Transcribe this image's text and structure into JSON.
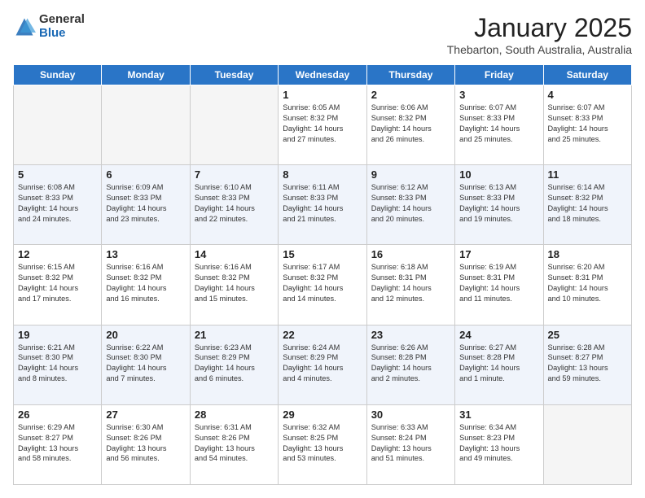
{
  "header": {
    "logo_general": "General",
    "logo_blue": "Blue",
    "month_title": "January 2025",
    "location": "Thebarton, South Australia, Australia"
  },
  "weekdays": [
    "Sunday",
    "Monday",
    "Tuesday",
    "Wednesday",
    "Thursday",
    "Friday",
    "Saturday"
  ],
  "weeks": [
    [
      {
        "day": "",
        "info": ""
      },
      {
        "day": "",
        "info": ""
      },
      {
        "day": "",
        "info": ""
      },
      {
        "day": "1",
        "info": "Sunrise: 6:05 AM\nSunset: 8:32 PM\nDaylight: 14 hours\nand 27 minutes."
      },
      {
        "day": "2",
        "info": "Sunrise: 6:06 AM\nSunset: 8:32 PM\nDaylight: 14 hours\nand 26 minutes."
      },
      {
        "day": "3",
        "info": "Sunrise: 6:07 AM\nSunset: 8:33 PM\nDaylight: 14 hours\nand 25 minutes."
      },
      {
        "day": "4",
        "info": "Sunrise: 6:07 AM\nSunset: 8:33 PM\nDaylight: 14 hours\nand 25 minutes."
      }
    ],
    [
      {
        "day": "5",
        "info": "Sunrise: 6:08 AM\nSunset: 8:33 PM\nDaylight: 14 hours\nand 24 minutes."
      },
      {
        "day": "6",
        "info": "Sunrise: 6:09 AM\nSunset: 8:33 PM\nDaylight: 14 hours\nand 23 minutes."
      },
      {
        "day": "7",
        "info": "Sunrise: 6:10 AM\nSunset: 8:33 PM\nDaylight: 14 hours\nand 22 minutes."
      },
      {
        "day": "8",
        "info": "Sunrise: 6:11 AM\nSunset: 8:33 PM\nDaylight: 14 hours\nand 21 minutes."
      },
      {
        "day": "9",
        "info": "Sunrise: 6:12 AM\nSunset: 8:33 PM\nDaylight: 14 hours\nand 20 minutes."
      },
      {
        "day": "10",
        "info": "Sunrise: 6:13 AM\nSunset: 8:33 PM\nDaylight: 14 hours\nand 19 minutes."
      },
      {
        "day": "11",
        "info": "Sunrise: 6:14 AM\nSunset: 8:32 PM\nDaylight: 14 hours\nand 18 minutes."
      }
    ],
    [
      {
        "day": "12",
        "info": "Sunrise: 6:15 AM\nSunset: 8:32 PM\nDaylight: 14 hours\nand 17 minutes."
      },
      {
        "day": "13",
        "info": "Sunrise: 6:16 AM\nSunset: 8:32 PM\nDaylight: 14 hours\nand 16 minutes."
      },
      {
        "day": "14",
        "info": "Sunrise: 6:16 AM\nSunset: 8:32 PM\nDaylight: 14 hours\nand 15 minutes."
      },
      {
        "day": "15",
        "info": "Sunrise: 6:17 AM\nSunset: 8:32 PM\nDaylight: 14 hours\nand 14 minutes."
      },
      {
        "day": "16",
        "info": "Sunrise: 6:18 AM\nSunset: 8:31 PM\nDaylight: 14 hours\nand 12 minutes."
      },
      {
        "day": "17",
        "info": "Sunrise: 6:19 AM\nSunset: 8:31 PM\nDaylight: 14 hours\nand 11 minutes."
      },
      {
        "day": "18",
        "info": "Sunrise: 6:20 AM\nSunset: 8:31 PM\nDaylight: 14 hours\nand 10 minutes."
      }
    ],
    [
      {
        "day": "19",
        "info": "Sunrise: 6:21 AM\nSunset: 8:30 PM\nDaylight: 14 hours\nand 8 minutes."
      },
      {
        "day": "20",
        "info": "Sunrise: 6:22 AM\nSunset: 8:30 PM\nDaylight: 14 hours\nand 7 minutes."
      },
      {
        "day": "21",
        "info": "Sunrise: 6:23 AM\nSunset: 8:29 PM\nDaylight: 14 hours\nand 6 minutes."
      },
      {
        "day": "22",
        "info": "Sunrise: 6:24 AM\nSunset: 8:29 PM\nDaylight: 14 hours\nand 4 minutes."
      },
      {
        "day": "23",
        "info": "Sunrise: 6:26 AM\nSunset: 8:28 PM\nDaylight: 14 hours\nand 2 minutes."
      },
      {
        "day": "24",
        "info": "Sunrise: 6:27 AM\nSunset: 8:28 PM\nDaylight: 14 hours\nand 1 minute."
      },
      {
        "day": "25",
        "info": "Sunrise: 6:28 AM\nSunset: 8:27 PM\nDaylight: 13 hours\nand 59 minutes."
      }
    ],
    [
      {
        "day": "26",
        "info": "Sunrise: 6:29 AM\nSunset: 8:27 PM\nDaylight: 13 hours\nand 58 minutes."
      },
      {
        "day": "27",
        "info": "Sunrise: 6:30 AM\nSunset: 8:26 PM\nDaylight: 13 hours\nand 56 minutes."
      },
      {
        "day": "28",
        "info": "Sunrise: 6:31 AM\nSunset: 8:26 PM\nDaylight: 13 hours\nand 54 minutes."
      },
      {
        "day": "29",
        "info": "Sunrise: 6:32 AM\nSunset: 8:25 PM\nDaylight: 13 hours\nand 53 minutes."
      },
      {
        "day": "30",
        "info": "Sunrise: 6:33 AM\nSunset: 8:24 PM\nDaylight: 13 hours\nand 51 minutes."
      },
      {
        "day": "31",
        "info": "Sunrise: 6:34 AM\nSunset: 8:23 PM\nDaylight: 13 hours\nand 49 minutes."
      },
      {
        "day": "",
        "info": ""
      }
    ]
  ]
}
